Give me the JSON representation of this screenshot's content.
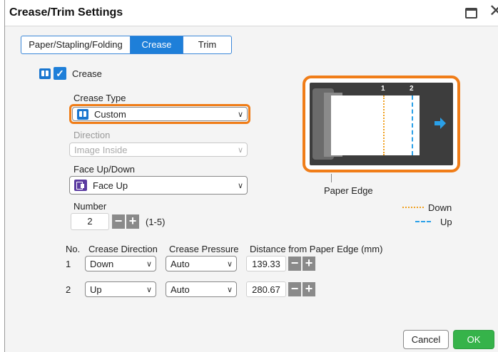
{
  "window": {
    "title": "Crease/Trim Settings"
  },
  "tabs": [
    {
      "label": "Paper/Stapling/Folding",
      "active": false
    },
    {
      "label": "Crease",
      "active": true
    },
    {
      "label": "Trim",
      "active": false
    }
  ],
  "crease": {
    "label": "Crease",
    "checked": true
  },
  "crease_type": {
    "label": "Crease Type",
    "value": "Custom"
  },
  "direction": {
    "label": "Direction",
    "value": "Image Inside",
    "enabled": false
  },
  "face": {
    "label": "Face Up/Down",
    "value": "Face Up"
  },
  "number": {
    "label": "Number",
    "value": "2",
    "range": "(1-5)"
  },
  "table": {
    "headers": {
      "no": "No.",
      "direction": "Crease Direction",
      "pressure": "Crease Pressure",
      "distance": "Distance from Paper Edge (mm)"
    },
    "rows": [
      {
        "no": "1",
        "direction": "Down",
        "pressure": "Auto",
        "distance": "139.33"
      },
      {
        "no": "2",
        "direction": "Up",
        "pressure": "Auto",
        "distance": "280.67"
      }
    ]
  },
  "preview": {
    "fold1": "1",
    "fold2": "2",
    "paper_edge_label": "Paper Edge"
  },
  "legend": {
    "down": "Down",
    "up": "Up"
  },
  "colors": {
    "accent": "#1e7fd9",
    "highlight": "#f07d18",
    "ok": "#36b34a",
    "down_line": "#f0a020",
    "up_line": "#2aa0e8"
  },
  "buttons": {
    "cancel": "Cancel",
    "ok": "OK"
  },
  "icons": {
    "close": "close-icon",
    "window": "window-icon",
    "crease": "book-icon",
    "face": "face-up-icon",
    "arrow": "arrow-right-icon"
  }
}
